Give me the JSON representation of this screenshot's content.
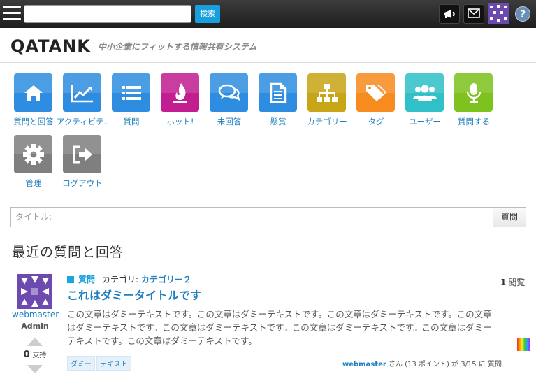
{
  "topbar": {
    "search_placeholder": "",
    "search_button": "検索"
  },
  "header": {
    "logo": "QATANK",
    "tagline": "中小企業にフィットする情報共有システム"
  },
  "nav": {
    "items": [
      {
        "label": "質問と回答",
        "color": "#2e8de0",
        "icon": "home-icon"
      },
      {
        "label": "アクティビテ..",
        "color": "#2e8de0",
        "icon": "activity-chart-icon"
      },
      {
        "label": "質問",
        "color": "#2e8de0",
        "icon": "list-icon"
      },
      {
        "label": "ホット!",
        "color": "#c21e91",
        "icon": "flame-icon"
      },
      {
        "label": "未回答",
        "color": "#2e8de0",
        "icon": "speech-bubbles-icon"
      },
      {
        "label": "懸賞",
        "color": "#2e8de0",
        "icon": "document-icon"
      },
      {
        "label": "カテゴリー",
        "color": "#c8a516",
        "icon": "sitemap-icon"
      },
      {
        "label": "タグ",
        "color": "#f68b1f",
        "icon": "tags-icon"
      },
      {
        "label": "ユーザー",
        "color": "#2fc0c8",
        "icon": "users-icon"
      },
      {
        "label": "質問する",
        "color": "#7dc21e",
        "icon": "microphone-icon"
      },
      {
        "label": "管理",
        "color": "#7f7f7f",
        "icon": "gear-icon"
      },
      {
        "label": "ログアウト",
        "color": "#7f7f7f",
        "icon": "logout-icon"
      }
    ]
  },
  "ask": {
    "placeholder": "タイトル:",
    "button": "質問"
  },
  "recent": {
    "title": "最近の質問と回答"
  },
  "question": {
    "kind": "質問",
    "category_label": "カテゴリ: ",
    "category": "カテゴリー２",
    "title": "これはダミータイトルです",
    "body": "この文章はダミーテキストです。この文章はダミーテキストです。この文章はダミーテキストです。この文章はダミーテキストです。この文章はダミーテキストです。この文章はダミーテキストです。この文章はダミーテキストです。この文章はダミーテキストです。",
    "views_count": "1",
    "views_label": "閲覧",
    "user": "webmaster",
    "role": "Admin",
    "votes": "0",
    "votes_label": "支持",
    "tags": [
      "ダミー",
      "テキスト"
    ],
    "footer_user": "webmaster",
    "footer_rest": " さん (13 ポイント) が 3/15 に 質問"
  }
}
